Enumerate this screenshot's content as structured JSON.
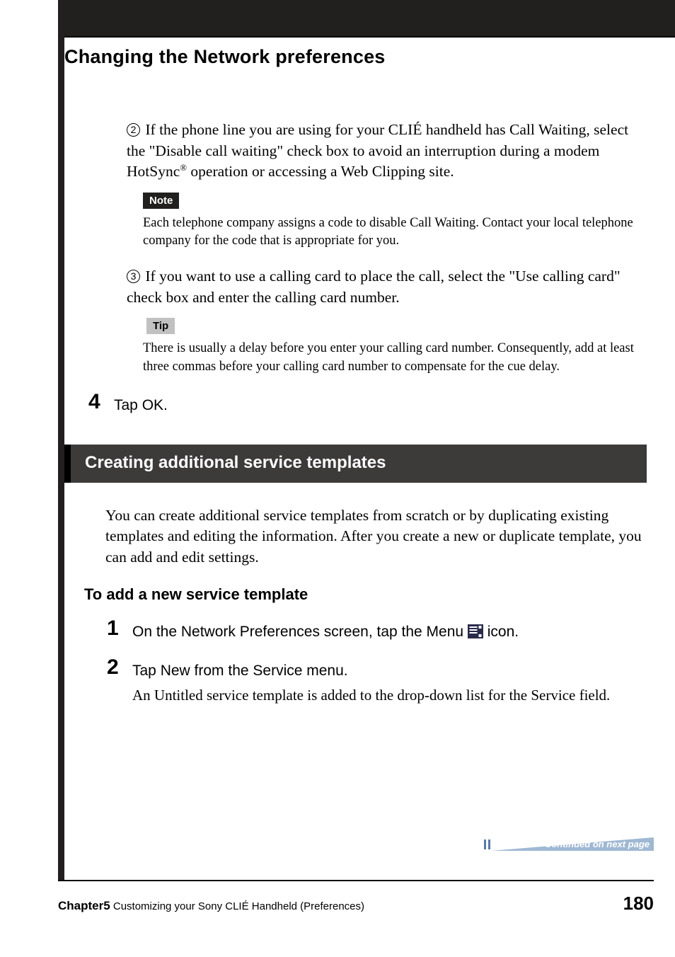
{
  "header": {
    "section_title": "Changing the Network preferences"
  },
  "steps_upper": {
    "item2_num": "2",
    "item2_text_1": " If the phone line you are using for your CLIÉ handheld has Call Waiting, select the \"Disable call waiting\" check box to avoid an interruption during a modem HotSync",
    "item2_reg": "®",
    "item2_text_2": " operation or accessing a Web Clipping site.",
    "note_label": "Note",
    "note_text": "Each telephone company assigns a code to disable Call Waiting. Contact your local telephone company for the code that is appropriate for you.",
    "item3_num": "3",
    "item3_text": " If you want to use a calling card to place the call, select the \"Use calling card\" check box and enter the calling card number.",
    "tip_label": "Tip",
    "tip_text": "There is usually a delay before you enter your calling card number. Consequently, add at least three commas before your calling card number to compensate for the cue delay."
  },
  "step4": {
    "num": "4",
    "text": "Tap OK."
  },
  "subsection": {
    "heading": "Creating additional service templates",
    "intro": "You can create additional service templates from scratch or by duplicating existing templates and editing the information. After you create a new or duplicate template, you can add and edit settings.",
    "subheading": "To add a new service template"
  },
  "step1": {
    "num": "1",
    "text_before": "On the Network Preferences screen, tap the Menu ",
    "text_after": " icon."
  },
  "step2": {
    "num": "2",
    "text": "Tap New from the Service menu.",
    "detail": "An Untitled service template is added to the drop-down list for the Service field."
  },
  "continued": "Continued on next page",
  "footer": {
    "chapter_label": "Chapter5",
    "chapter_text": "  Customizing your Sony CLIÉ Handheld (Preferences)",
    "page_number": "180"
  }
}
